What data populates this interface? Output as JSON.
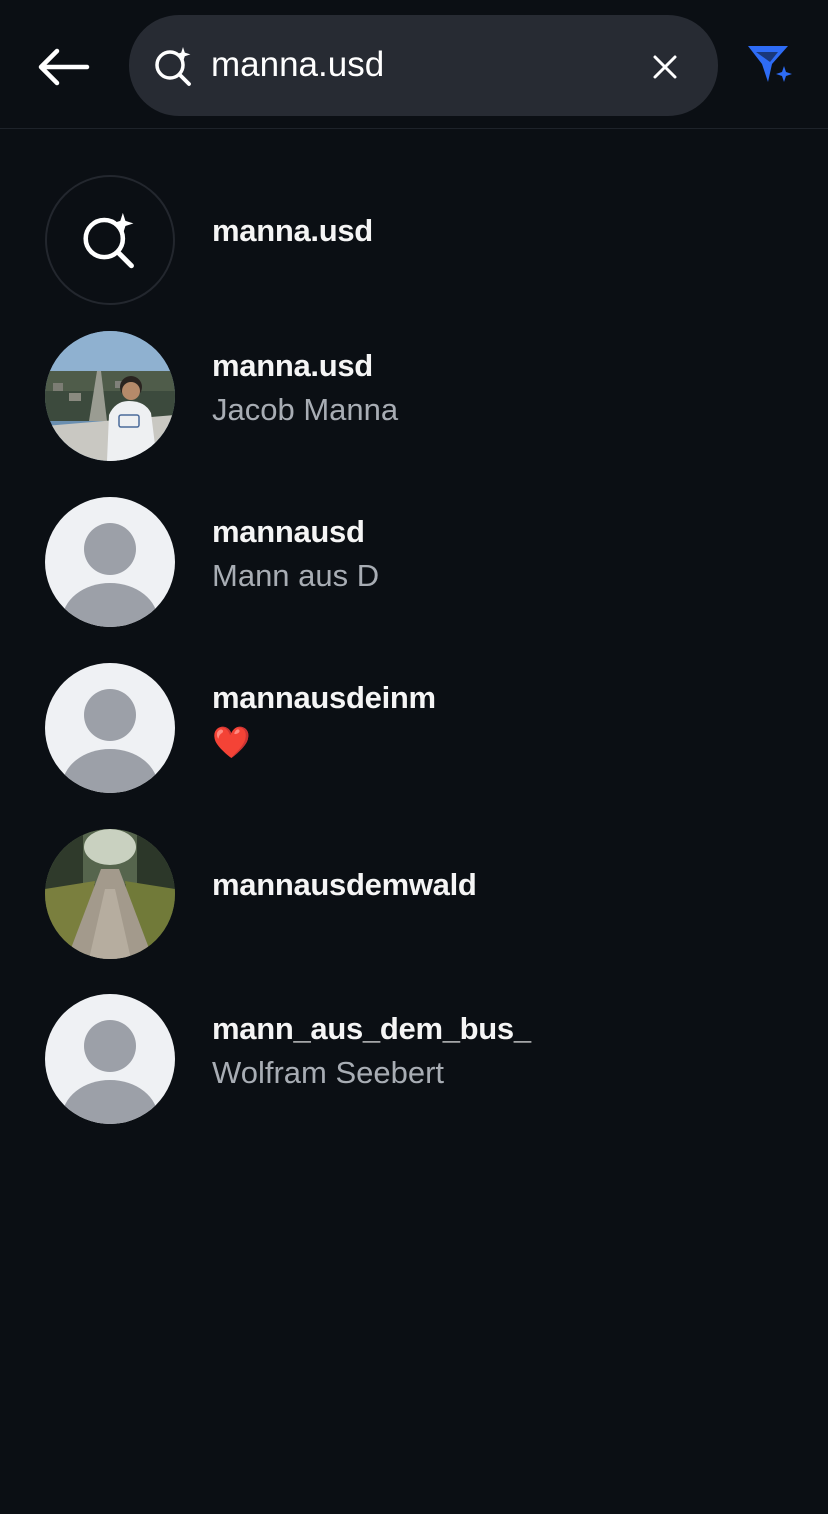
{
  "header": {
    "back_icon": "arrow-left-icon",
    "search_icon": "ai-search-icon",
    "search_query": "manna.usd",
    "clear_icon": "close-icon",
    "filter_icon": "ai-filter-icon",
    "accent_color": "#2e6cf6"
  },
  "results": {
    "ai_suggestion": {
      "label": "manna.usd",
      "icon": "ai-search-icon"
    },
    "users": [
      {
        "username": "manna.usd",
        "fullname": "Jacob Manna",
        "avatar": "city-photo"
      },
      {
        "username": "mannausd",
        "fullname": "Mann aus D",
        "avatar": "default-avatar"
      },
      {
        "username": "mannausdeinm",
        "fullname": "❤️",
        "avatar": "default-avatar"
      },
      {
        "username": "mannausdemwald",
        "fullname": "",
        "avatar": "forest-path-photo"
      },
      {
        "username": "mann_aus_dem_bus_",
        "fullname": "Wolfram Seebert",
        "avatar": "default-avatar"
      }
    ]
  }
}
